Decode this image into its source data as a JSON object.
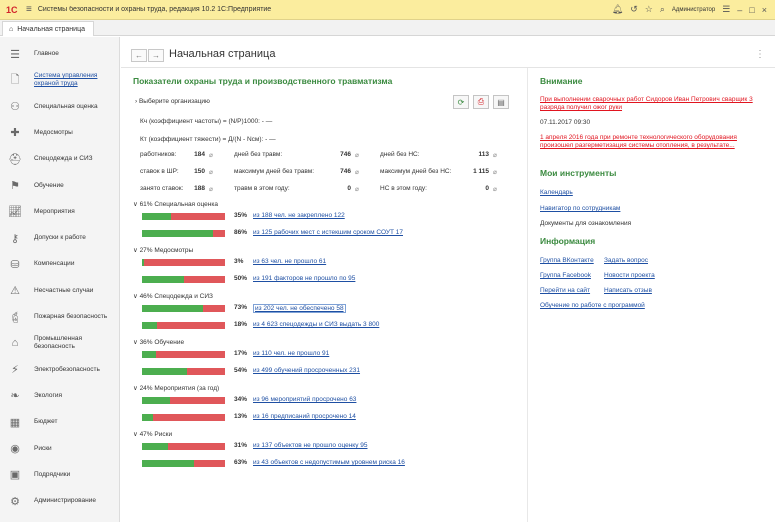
{
  "titlebar": {
    "logo": "1С",
    "title": "Системы безопасности и охраны труда, редакция 10.2 1С:Предприятие",
    "user": "Администратор",
    "icons": [
      "bell-icon",
      "history-icon",
      "star-icon",
      "search-icon",
      "settings-icon",
      "minimize-icon",
      "maximize-icon",
      "close-icon"
    ]
  },
  "tabs": [
    {
      "label": "Начальная страница",
      "icon": "home-icon"
    }
  ],
  "sidebar": {
    "items": [
      {
        "label": "Главное",
        "icon": "menu-lines-icon",
        "link": false
      },
      {
        "label": "Система управления охраной труда",
        "icon": "document-icon",
        "link": true
      },
      {
        "label": "Специальная оценка",
        "icon": "person-check-icon",
        "link": false
      },
      {
        "label": "Медосмотры",
        "icon": "medical-icon",
        "link": false
      },
      {
        "label": "Спецодежда и СИЗ",
        "icon": "helmet-icon",
        "link": false
      },
      {
        "label": "Обучение",
        "icon": "graduation-icon",
        "link": false
      },
      {
        "label": "Мероприятия",
        "icon": "chart-icon",
        "link": false
      },
      {
        "label": "Допуски к работе",
        "icon": "key-icon",
        "link": false
      },
      {
        "label": "Компенсации",
        "icon": "coins-icon",
        "link": false
      },
      {
        "label": "Несчастные случаи",
        "icon": "warning-icon",
        "link": false
      },
      {
        "label": "Пожарная безопасность",
        "icon": "fire-extinguisher-icon",
        "link": false
      },
      {
        "label": "Промышленная безопасность",
        "icon": "factory-icon",
        "link": false
      },
      {
        "label": "Электробезопасность",
        "icon": "lightning-icon",
        "link": false
      },
      {
        "label": "Экология",
        "icon": "leaf-icon",
        "link": false
      },
      {
        "label": "Бюджет",
        "icon": "calculator-icon",
        "link": false
      },
      {
        "label": "Риски",
        "icon": "risk-icon",
        "link": false
      },
      {
        "label": "Подрядчики",
        "icon": "contractor-icon",
        "link": false
      },
      {
        "label": "Администрирование",
        "icon": "gear-icon",
        "link": false
      }
    ]
  },
  "main": {
    "back": "←",
    "forward": "→",
    "title": "Начальная страница",
    "section_title": "Показатели охраны труда и производственного травматизма",
    "org_select": "› Выберите организацию",
    "coef_kch": "Кч (коэффициент частоты) = (N/P)1000:   -  —",
    "coef_kt": "Кт (коэффициент тяжести) = Д/(N - Nсм):   -  —",
    "stats": [
      {
        "label": "работников:",
        "value": "184"
      },
      {
        "label": "дней без травм:",
        "value": "746"
      },
      {
        "label": "дней без НС:",
        "value": "113"
      },
      {
        "label": "ставок в ШР:",
        "value": "150"
      },
      {
        "label": "максимум дней без травм:",
        "value": "746"
      },
      {
        "label": "максимум дней без НС:",
        "value": "1 115"
      },
      {
        "label": "занято ставок:",
        "value": "188"
      },
      {
        "label": "травм в этом году:",
        "value": "0"
      },
      {
        "label": "НС в этом году:",
        "value": "0"
      }
    ],
    "groups": [
      {
        "head": "∨  61% Специальная оценка",
        "rows": [
          {
            "pct": "35%",
            "fill": 0.35,
            "link": "из 188 чел. не закреплено 122"
          },
          {
            "pct": "86%",
            "fill": 0.86,
            "link": "из 125 рабочих мест с истекшим сроком СОУТ 17"
          }
        ]
      },
      {
        "head": "∨  27% Медосмотры",
        "rows": [
          {
            "pct": "3%",
            "fill": 0.03,
            "link": "из 63 чел. не прошло 61"
          },
          {
            "pct": "50%",
            "fill": 0.5,
            "link": "из 191 факторов не прошло по 95"
          }
        ]
      },
      {
        "head": "∨  46% Спецодежда и СИЗ",
        "rows": [
          {
            "pct": "73%",
            "fill": 0.73,
            "link": "из 202 чел. не обеспечено 58"
          },
          {
            "pct": "18%",
            "fill": 0.18,
            "link": "из 4 623 спецодежды и СИЗ выдать 3 800"
          }
        ]
      },
      {
        "head": "∨  36% Обучение",
        "rows": [
          {
            "pct": "17%",
            "fill": 0.17,
            "link": "из 110 чел. не прошло 91"
          },
          {
            "pct": "54%",
            "fill": 0.54,
            "link": "из 499 обучений просроченных 231"
          }
        ]
      },
      {
        "head": "∨  24% Мероприятия (за год)",
        "rows": [
          {
            "pct": "34%",
            "fill": 0.34,
            "link": "из 96 мероприятий просрочено 63"
          },
          {
            "pct": "13%",
            "fill": 0.13,
            "link": "из 16 предписаний просрочено 14"
          }
        ]
      },
      {
        "head": "∨  47% Риски",
        "rows": [
          {
            "pct": "31%",
            "fill": 0.31,
            "link": "из 137 объектов не прошло оценку 95"
          },
          {
            "pct": "63%",
            "fill": 0.63,
            "link": "из 43 объектов с недопустимым уровнем риска 16"
          }
        ]
      }
    ]
  },
  "right": {
    "attention_title": "Внимание",
    "alert1": "При выполнении сварочных работ Сидоров Иван Петрович сварщик 3 разряда получил ожог руки",
    "date": "07.11.2017 09:30",
    "alert2": "1 апреля 2016 года при ремонте технологического оборудования произошел разгерметизация системы отопления, в результате...",
    "tools_title": "Мои инструменты",
    "tools": [
      "Календарь",
      "Навигатор по сотрудникам"
    ],
    "tools_text": "Документы для ознакомления",
    "info_title": "Информация",
    "info_links": [
      "Группа ВКонтакте",
      "Задать вопрос",
      "Группа Facebook",
      "Новости проекта",
      "Перейти на сайт",
      "Написать отзыв",
      "Обучение по работе с программой"
    ]
  },
  "colors": {
    "accent": "#3a8a3f",
    "link": "#1e4fa3",
    "alert": "#e1141f",
    "bar_good": "#4cae4f",
    "bar_bad": "#e0575a",
    "titlebar": "#fbed9e"
  }
}
